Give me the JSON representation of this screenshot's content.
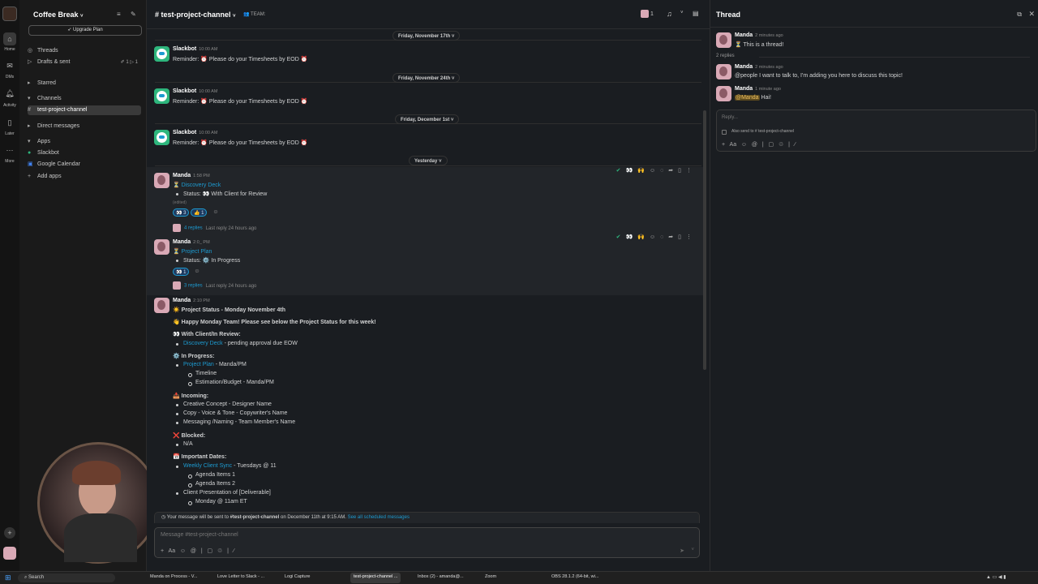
{
  "rail": {
    "items": [
      {
        "label": "Home",
        "icon": "home-icon"
      },
      {
        "label": "DMs",
        "icon": "dm-icon"
      },
      {
        "label": "Activity",
        "icon": "bell-icon"
      },
      {
        "label": "Later",
        "icon": "bookmark-icon"
      },
      {
        "label": "More",
        "icon": "more-icon"
      }
    ]
  },
  "sidebar": {
    "workspace": "Coffee Break",
    "upgrade_label": "Upgrade Plan",
    "threads": "Threads",
    "drafts": "Drafts & sent",
    "drafts_counts": "✐ 1  ▷ 1",
    "starred": "Starred",
    "channels": "Channels",
    "active_channel": "test-project-channel",
    "direct_messages": "Direct messages",
    "apps": "Apps",
    "app_items": [
      "Slackbot",
      "Google Calendar",
      "Add apps"
    ]
  },
  "header": {
    "channel": "# test-project-channel",
    "chevron": "˅",
    "tag": "👥 TEAM:",
    "member_count": "1"
  },
  "days": [
    "Friday, November 17th",
    "Friday, November 24th",
    "Friday, December 1st",
    "Yesterday"
  ],
  "slackbot": {
    "name": "Slackbot",
    "time": "10:00 AM",
    "text": "Reminder: ⏰ Please do your Timesheets by EOD ⏰"
  },
  "msg1": {
    "name": "Manda",
    "time": "1:58 PM",
    "link": "Discovery Deck",
    "status": "Status: 👀 With Client for Review",
    "edited": "(edited)",
    "reactions": [
      "👀 3",
      "👍 1"
    ],
    "replies": "4 replies",
    "last_reply": "Last reply 24 hours ago"
  },
  "msg2": {
    "name": "Manda",
    "time": "2:0_ PM",
    "link": "Project Plan",
    "status": "Status: ⚙️ In Progress",
    "reactions": [
      "👀 1"
    ],
    "replies": "3 replies",
    "last_reply": "Last reply 24 hours ago"
  },
  "msg3": {
    "name": "Manda",
    "time": "2:10 PM",
    "title": "☀️ Project Status - Monday November 4th",
    "intro": "👋 Happy Monday Team! Please see below the Project Status for this week!",
    "review_head": "👀 With Client/In Review:",
    "review_link": "Discovery Deck",
    "review_text": " - pending approval due EOW",
    "progress_head": "⚙️ In Progress:",
    "progress_link": "Project Plan",
    "progress_text": " - Manda/PM",
    "progress_sub": [
      "Timeline",
      "Estimation/Budget - Manda/PM"
    ],
    "incoming_head": "📥 Incoming:",
    "incoming": [
      "Creative Concept - Designer Name",
      "Copy - Voice & Tone - Copywriter's Name",
      "Messaging /Naming - Team Member's Name"
    ],
    "blocked_head": "❌ Blocked:",
    "blocked": "N/A",
    "dates_head": "📅 Important Dates:",
    "sync_link": "Weekly Client Sync",
    "sync_text": " - Tuesdays @ 11",
    "agenda": [
      "Agenda Items 1",
      "Agenda Items 2"
    ],
    "presentation": "Client Presentation of [Deliverable]",
    "presentation_sub": "Monday @ 11am ET"
  },
  "scheduled": {
    "prefix": "Your message will be sent to ",
    "channel": "#test-project-channel",
    "suffix": " on December 11th at 9:15 AM.",
    "link": "See all scheduled messages"
  },
  "composer": {
    "placeholder": "Message #test-project-channel",
    "tools": "+   Aa   ☺   @   |   ▢   ♲   |   ∕"
  },
  "thread": {
    "title": "Thread",
    "root_name": "Manda",
    "root_time": "2 minutes ago",
    "root_text": "⏳ This is a thread!",
    "reply_count": "2 replies",
    "r1_name": "Manda",
    "r1_time": "2 minutes ago",
    "r1_text": "@people I want to talk to, I'm adding you here to discuss this topic!",
    "r2_name": "Manda",
    "r2_time": "1 minute ago",
    "r2_mention": "@Manda",
    "r2_text": " Hai!",
    "reply_placeholder": "Reply...",
    "also_send": "Also send to # test-project-channel"
  },
  "taskbar": {
    "search": "Search",
    "apps": [
      "Manda on Process - V...",
      "Love Letter to Slack - ...",
      "Logi Capture",
      "test-project-channel ...",
      "Inbox (2) - amanda@...",
      "Zoom",
      "OBS 28.1.2 (64-bit, wi..."
    ]
  },
  "colors": {
    "link": "#1d9bd1",
    "mention": "#e8912d",
    "bot": "#2eb67d"
  }
}
